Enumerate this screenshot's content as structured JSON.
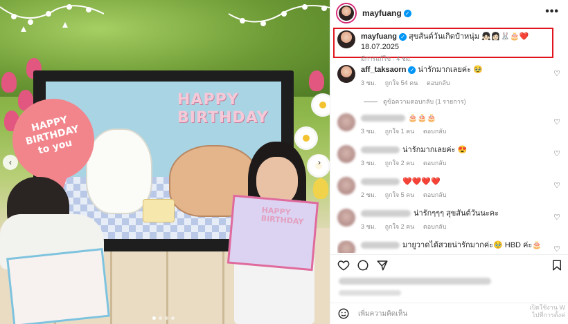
{
  "post": {
    "username": "mayfuang",
    "image_bubble_text": "HAPPY BIRTHDAY to you",
    "artwork_text": "HAPPY BIRTHDAY",
    "card_text": "HAPPY BIRTHDAY",
    "carousel_dots": 4,
    "carousel_active": 1
  },
  "header": {
    "username": "mayfuang",
    "more_label": "•••"
  },
  "caption": {
    "username": "mayfuang",
    "text": "สุขสันต์วันเกิดป๋าหนุ่ม 👧🏻👩🏻🐰🎂❤️ 18.07.2025",
    "meta": "มีการแก้ไข · 4 ชม."
  },
  "comments": [
    {
      "user": "aff_taksaorn",
      "verified": true,
      "text": "น่ารักมากเลยค่ะ 🥹",
      "time": "3 ชม.",
      "likes": "ถูกใจ 54 คน",
      "reply": "ตอบกลับ"
    },
    {
      "user": "",
      "text": "🎂🎂🎂",
      "time": "3 ชม.",
      "likes": "ถูกใจ 1 คน",
      "reply": "ตอบกลับ"
    },
    {
      "user": "",
      "text": "น่ารักมากเลยค่ะ 😍",
      "time": "3 ชม.",
      "likes": "ถูกใจ 2 คน",
      "reply": "ตอบกลับ"
    },
    {
      "user": "",
      "text": "❤️❤️❤️❤️",
      "time": "2 ชม.",
      "likes": "ถูกใจ 5 คน",
      "reply": "ตอบกลับ"
    },
    {
      "user": "",
      "text": "น่ารักๆๆๆ สุขสันต์วันนะคะ",
      "time": "3 ชม.",
      "likes": "ถูกใจ 2 คน",
      "reply": "ตอบกลับ"
    },
    {
      "user": "",
      "text": "มายูวาดได้สวยน่ารักมากค่ะ🥹 HBD ค่ะ🎂",
      "time": "",
      "likes": "",
      "reply": ""
    }
  ],
  "view_replies": "ดูข้อความตอบกลับ (1 รายการ)",
  "add_comment_placeholder": "เพิ่มความคิดเห็น",
  "watermark": {
    "line1": "เปิดใช้งาน W",
    "line2": "ไปที่การตั้งค่"
  },
  "colors": {
    "verified": "#0095f6",
    "highlight_border": "#e0161e",
    "story_ring": "#d62976"
  }
}
